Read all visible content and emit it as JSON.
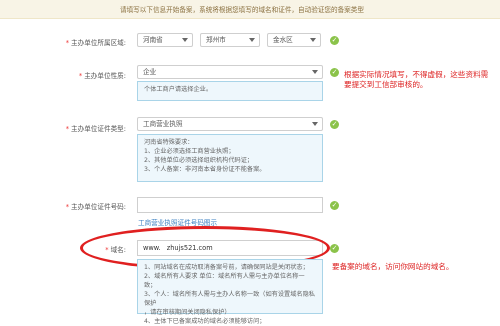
{
  "notice": "请填写以下信息开始备案，系统将根据您填写的域名和证件，自动验证您的备案类型",
  "region": {
    "label": "主办单位所属区域:",
    "province": "河南省",
    "city": "郑州市",
    "district": "金水区"
  },
  "nature": {
    "label": "主办单位性质:",
    "value": "企业",
    "tip": "个体工商户请选择企业。"
  },
  "cert_type": {
    "label": "主办单位证件类型:",
    "value": "工商营业执照",
    "tip_title": "河南省特殊要求：",
    "tip_items": [
      "1、企业必须选择工商营业执照；",
      "2、其他单位必须选择组织机构代码证；",
      "3、个人备案：非河南本省身份证不能备案。"
    ]
  },
  "cert_number": {
    "label": "主办单位证件号码:",
    "value": "",
    "sample_link": "工商营业执照证件号码图示"
  },
  "domain": {
    "label": "域名:",
    "prefix": "www.",
    "value": "zhujs521.com",
    "tip_items": [
      "1、同站域名在成功取消备案号前，请确保同站是关闭状态；",
      "2、域名所有人要求 单位：域名所有人需与主办单位名称一致；",
      "3、个人：域名所有人需与主办人名称一致（如有设置域名隐私保护",
      "，请在审核期间关闭隐私保护）",
      "4、主体下已备案成功的域名必须能够访问；"
    ]
  },
  "annotations": {
    "side_note": "根据实际情况填写，不得虚假，这些资料需要提交到工信部审核的。",
    "domain_note": "要备案的域名，访问你网站的域名。"
  },
  "colors": {
    "accent_check": "#8bc34a",
    "annotation_red": "#e02020",
    "tip_border": "#a9d4e8",
    "link": "#3a7fc1"
  }
}
